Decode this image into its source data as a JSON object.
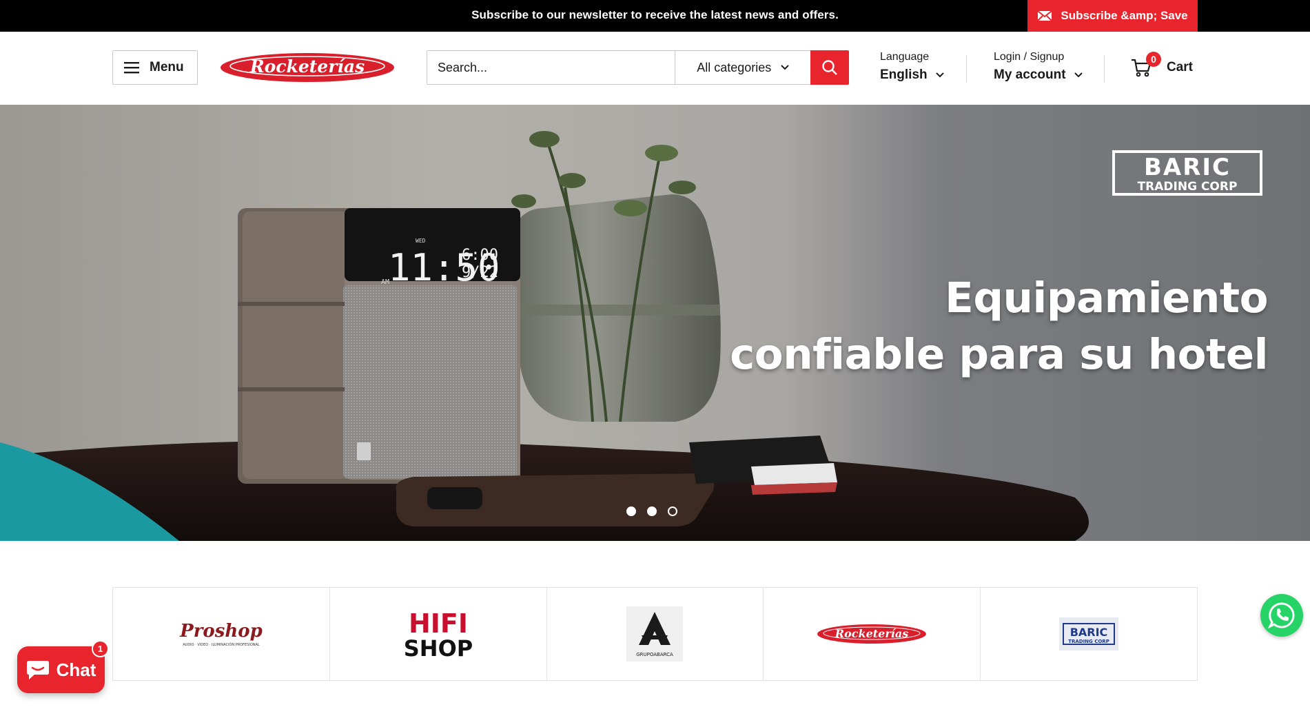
{
  "announcement": {
    "text": "Subscribe to our newsletter to receive the latest news and offers.",
    "subscribe_label": "Subscribe &amp; Save",
    "subscribe_icon": "envelope-icon"
  },
  "header": {
    "menu_label": "Menu",
    "logo_text": "Rocketerías",
    "search": {
      "placeholder": "Search...",
      "category_label": "All categories",
      "button_icon": "search-icon"
    },
    "language": {
      "label": "Language",
      "value": "English"
    },
    "account": {
      "label": "Login / Signup",
      "value": "My account"
    },
    "cart": {
      "count": "0",
      "label": "Cart"
    }
  },
  "hero": {
    "brand_logo_line1": "BARIC",
    "brand_logo_line2": "TRADING CORP",
    "title_line1": "Equipamiento",
    "title_line2": "confiable para su hotel",
    "clock_time": "11:50",
    "clock_alarm": "6:00",
    "clock_date": "9/22",
    "clock_am": "AM",
    "clock_day": "WED",
    "slides": 3,
    "active_slide": 3
  },
  "brands": [
    {
      "name": "Proshop",
      "subtitle": "AUDIO · VIDEO · ILUMINACIÓN PROFESIONAL"
    },
    {
      "name_line1": "HIFI",
      "name_line2": "SHOP"
    },
    {
      "name": "GRUPOABARCA"
    },
    {
      "name": "Rocketerías"
    },
    {
      "name_line1": "BARIC",
      "name_line2": "TRADING CORP"
    }
  ],
  "chat": {
    "label": "Chat",
    "badge": "1"
  },
  "colors": {
    "accent": "#e8242c",
    "announcement_bg": "#000000",
    "whatsapp": "#25d366"
  }
}
